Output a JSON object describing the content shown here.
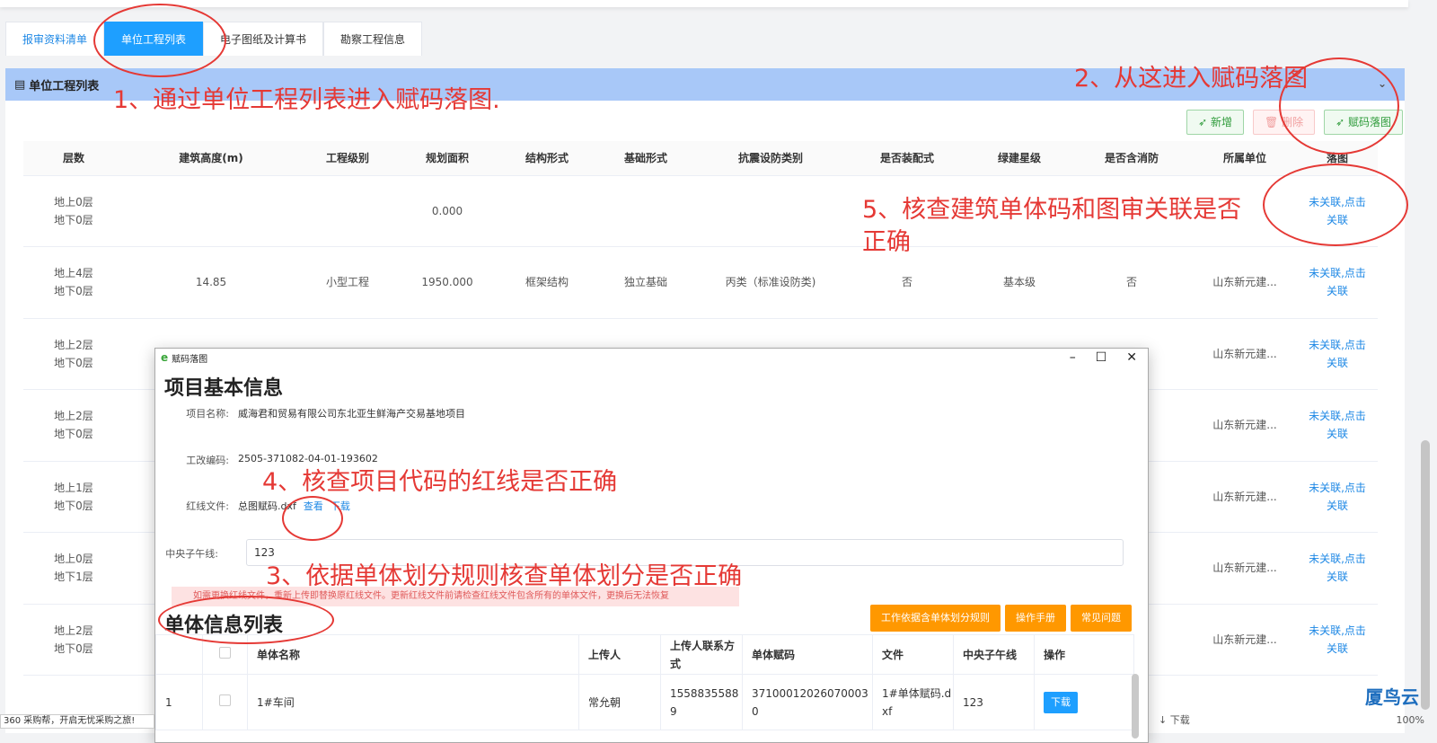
{
  "tabs": [
    "报审资料清单",
    "单位工程列表",
    "电子图纸及计算书",
    "勘察工程信息"
  ],
  "panel": {
    "title": "单位工程列表",
    "chevron": "⌄"
  },
  "buttons": {
    "add": "新增",
    "delete": "删除",
    "code_map": "赋码落图"
  },
  "table": {
    "headers": [
      "层数",
      "建筑高度(m)",
      "工程级别",
      "规划面积",
      "结构形式",
      "基础形式",
      "抗震设防类别",
      "是否装配式",
      "绿建星级",
      "是否含消防",
      "所属单位",
      "落图"
    ],
    "rows": [
      {
        "floors1": "地上0层",
        "floors2": "地下0层",
        "height": "",
        "level": "",
        "area": "0.000",
        "struct": "",
        "base": "",
        "quake": "",
        "prefab": "",
        "green": "",
        "fire": "",
        "unit": "",
        "link1": "未关联,点击",
        "link2": "关联"
      },
      {
        "floors1": "地上4层",
        "floors2": "地下0层",
        "height": "14.85",
        "level": "小型工程",
        "area": "1950.000",
        "struct": "框架结构",
        "base": "独立基础",
        "quake": "丙类（标准设防类)",
        "prefab": "否",
        "green": "基本级",
        "fire": "否",
        "unit": "山东新元建...",
        "link1": "未关联,点击",
        "link2": "关联"
      },
      {
        "floors1": "地上2层",
        "floors2": "地下0层",
        "height": "",
        "level": "",
        "area": "",
        "struct": "",
        "base": "",
        "quake": "",
        "prefab": "",
        "green": "",
        "fire": "",
        "unit": "山东新元建...",
        "link1": "未关联,点击",
        "link2": "关联"
      },
      {
        "floors1": "地上2层",
        "floors2": "地下0层",
        "height": "",
        "level": "",
        "area": "",
        "struct": "",
        "base": "",
        "quake": "",
        "prefab": "",
        "green": "",
        "fire": "",
        "unit": "山东新元建...",
        "link1": "未关联,点击",
        "link2": "关联"
      },
      {
        "floors1": "地上1层",
        "floors2": "地下0层",
        "height": "",
        "level": "",
        "area": "",
        "struct": "",
        "base": "",
        "quake": "",
        "prefab": "",
        "green": "",
        "fire": "",
        "unit": "山东新元建...",
        "link1": "未关联,点击",
        "link2": "关联"
      },
      {
        "floors1": "地上0层",
        "floors2": "地下1层",
        "height": "",
        "level": "",
        "area": "",
        "struct": "",
        "base": "",
        "quake": "",
        "prefab": "",
        "green": "",
        "fire": "",
        "unit": "山东新元建...",
        "link1": "未关联,点击",
        "link2": "关联"
      },
      {
        "floors1": "地上2层",
        "floors2": "地下0层",
        "height": "",
        "level": "",
        "area": "",
        "struct": "",
        "base": "",
        "quake": "",
        "prefab": "",
        "green": "",
        "fire": "",
        "unit": "山东新元建...",
        "link1": "未关联,点击",
        "link2": "关联"
      }
    ]
  },
  "modal": {
    "window_title": "赋码落图",
    "win_min": "–",
    "win_max": "☐",
    "win_close": "✕",
    "heading": "项目基本信息",
    "project_name_label": "项目名称:",
    "project_name": "威海君和贸易有限公司东北亚生鲜海产交易基地项目",
    "code_label": "工改编码:",
    "code": "2505-371082-04-01-193602",
    "redline_label": "红线文件:",
    "redline_file": "总图赋码.dxf",
    "view": "查看",
    "download": "下载",
    "meridian_label": "中央子午线:",
    "meridian": "123",
    "warning": "如需更换红线文件，重新上传即替换原红线文件。更新红线文件前请检查红线文件包含所有的单体文件，更换后无法恢复",
    "list_heading": "单体信息列表",
    "btn_rule": "工作依据含单体划分规则",
    "btn_manual": "操作手册",
    "btn_faq": "常见问题",
    "sub_headers": [
      "",
      "单体名称",
      "上传人",
      "上传人联系方式",
      "单体赋码",
      "文件",
      "中央子午线",
      "操作"
    ],
    "sub_row": {
      "no": "1",
      "name": "1#车间",
      "uploader": "常允朝",
      "phone": "15588355889",
      "code": "371000120260700030",
      "file": "1#单体赋码.dxf",
      "meridian": "123",
      "op": "下载"
    }
  },
  "annotations": {
    "a1": "1、通过单位工程列表进入赋码落图.",
    "a2": "2、从这进入赋码落图",
    "a3": "3、依据单体划分规则核查单体划分是否正确",
    "a4": "4、核查项目代码的红线是否正确",
    "a5": "5、核查建筑单体码和图审关联是否正确"
  },
  "statusbar": "360 采购帮，开启无忧采购之旅!",
  "browser": {
    "download": "↓ 下载",
    "zoom": "100%"
  },
  "logo": "厦鸟云",
  "colors": {
    "accent": "#1e9fff",
    "annotation": "#e53935",
    "orange": "#ff9800"
  }
}
